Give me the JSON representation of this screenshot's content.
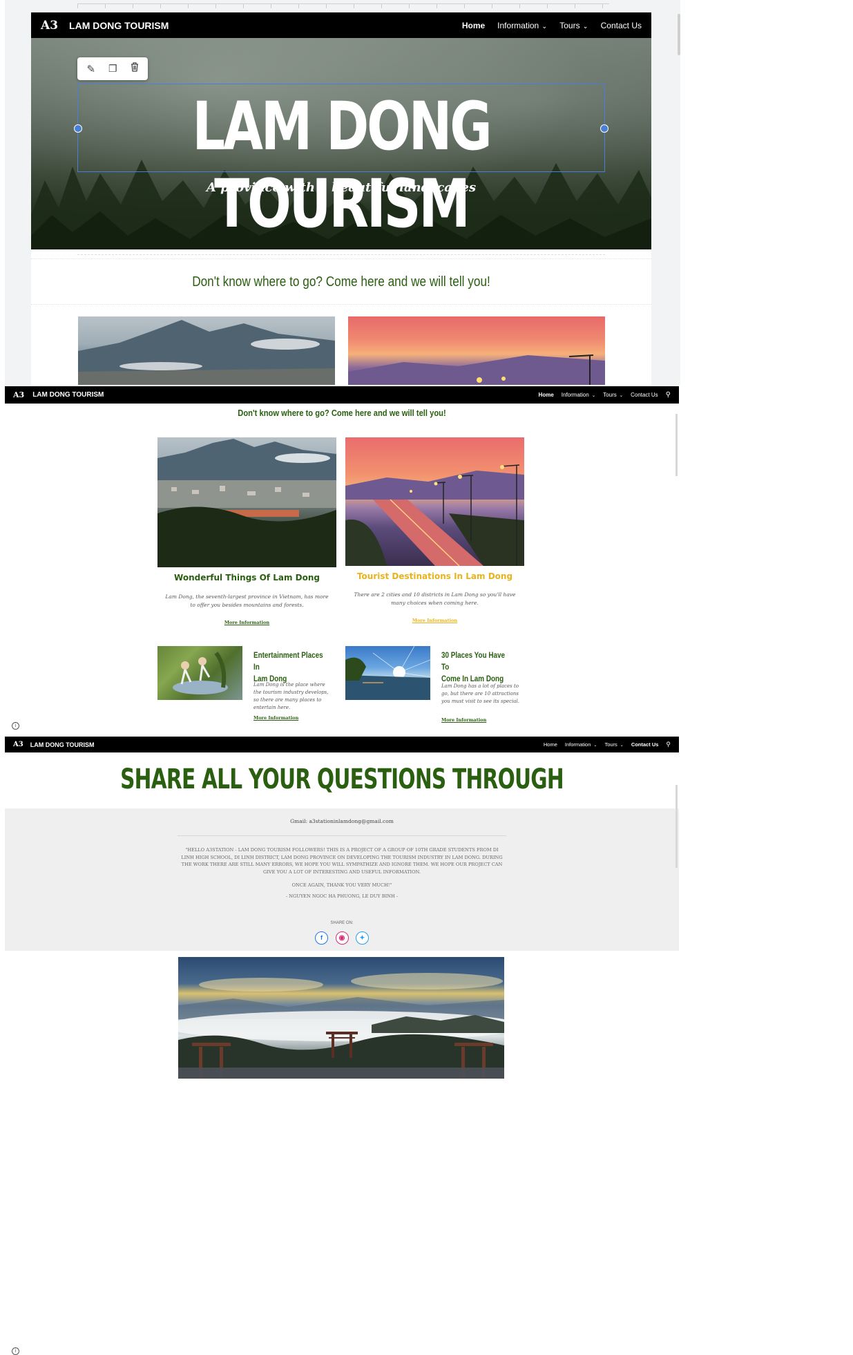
{
  "brand": {
    "logo": "A3",
    "name": "LAM DONG TOURISM"
  },
  "nav": {
    "home": "Home",
    "information": "Information",
    "tours": "Tours",
    "contact": "Contact Us"
  },
  "hero": {
    "title": "LAM DONG TOURISM",
    "subtitle": "A province with a beautiful landscapes"
  },
  "intro": {
    "tagline": "Don't know where to go? Come here and we will tell you!"
  },
  "cards": [
    {
      "title": "Wonderful Things Of Lam Dong",
      "text": "Lam Dong, the seventh-largest province in Vietnam, has more to offer you besides mountains and forests.",
      "link": "More Information"
    },
    {
      "title": "Tourist Destinations In Lam Dong",
      "text": "There are 2 cities and 10 districts in Lam Dong so you'll have many choices when coming here.",
      "link": "More Information"
    }
  ],
  "small_cards": [
    {
      "title_line1": "Entertainment Places In",
      "title_line2": "Lam Dong",
      "text": "Lam Dong is the place where the tourism industry develops, so there are many places to entertain here.",
      "link": "More Information"
    },
    {
      "title_line1": "30 Places You Have To",
      "title_line2": "Come In Lam Dong",
      "text": "Lam Dong has a lot of places to go, but there are 10 attractions you must visit to see its special.",
      "link": "More Information"
    }
  ],
  "contact": {
    "heading": "SHARE ALL YOUR QUESTIONS THROUGH",
    "email_label": "Gmail:",
    "email": "a3stationinlamdong@gmail.com",
    "message": "\"HELLO A3STATION - LAM DONG TOURISM FOLLOWERS! THIS IS A PROJECT OF A GROUP OF 10TH GRADE STUDENTS FROM DI LINH HIGH SCHOOL, DI LINH DISTRICT, LAM DONG PROVINCE ON DEVELOPING THE TOURISM INDUSTRY IN LAM DONG. DURING THE WORK THERE ARE STILL MANY ERRORS, WE HOPE YOU WILL SYMPATHIZE AND IGNORE THEM. WE HOPE OUR PROJECT CAN GIVE YOU A LOT OF INTERESTING AND USEFUL INFORMATION.",
    "thanks": "ONCE AGAIN, THANK YOU VERY MUCH!\"",
    "authors": "- NGUYEN NGOC HA PHUONG, LE DUY BINH -",
    "share_label": "SHARE ON:",
    "social": [
      "facebook-icon",
      "instagram-icon",
      "twitter-icon"
    ]
  },
  "colors": {
    "green": "#2a5f10",
    "yellow": "#e8b31c",
    "navbar": "#000000",
    "selection": "#4a7fd6"
  }
}
